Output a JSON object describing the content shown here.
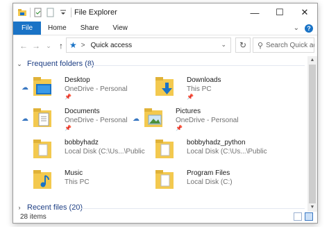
{
  "window": {
    "title": "File Explorer"
  },
  "ribbon": {
    "tabs": [
      {
        "label": "File"
      },
      {
        "label": "Home"
      },
      {
        "label": "Share"
      },
      {
        "label": "View"
      }
    ],
    "expand_glyph": "⌄",
    "help_glyph": "?"
  },
  "window_controls": {
    "minimize": "—",
    "maximize": "☐",
    "close": "✕"
  },
  "nav": {
    "back": "←",
    "forward": "→",
    "recent": "⌄",
    "up": "↑",
    "address_text": "Quick access",
    "address_chevron": ">",
    "address_dropdown": "⌄",
    "refresh": "↻",
    "search_placeholder": "Search Quick access"
  },
  "sections": {
    "frequent": {
      "label": "Frequent folders (8)",
      "expanded": true
    },
    "recent": {
      "label": "Recent files (20)",
      "expanded": false
    }
  },
  "folders": [
    {
      "name": "Desktop",
      "location": "OneDrive - Personal",
      "cloud": true,
      "pinned": true,
      "icon": "desktop-folder-icon"
    },
    {
      "name": "Downloads",
      "location": "This PC",
      "cloud": false,
      "pinned": true,
      "icon": "downloads-folder-icon"
    },
    {
      "name": "Documents",
      "location": "OneDrive - Personal",
      "cloud": true,
      "pinned": true,
      "icon": "documents-folder-icon"
    },
    {
      "name": "Pictures",
      "location": "OneDrive - Personal",
      "cloud": true,
      "pinned": true,
      "icon": "pictures-folder-icon"
    },
    {
      "name": "bobbyhadz",
      "location": "Local Disk (C:\\Us...\\Public",
      "cloud": false,
      "pinned": false,
      "icon": "folder-icon"
    },
    {
      "name": "bobbyhadz_python",
      "location": "Local Disk (C:\\Us...\\Public",
      "cloud": false,
      "pinned": false,
      "icon": "folder-icon"
    },
    {
      "name": "Music",
      "location": "This PC",
      "cloud": false,
      "pinned": false,
      "icon": "music-folder-icon"
    },
    {
      "name": "Program Files",
      "location": "Local Disk (C:)",
      "cloud": false,
      "pinned": false,
      "icon": "folder-icon"
    }
  ],
  "status": {
    "items": "28 items"
  },
  "colors": {
    "accent": "#1a73c6",
    "folder": "#f3c94f",
    "section_text": "#1e3f84"
  }
}
